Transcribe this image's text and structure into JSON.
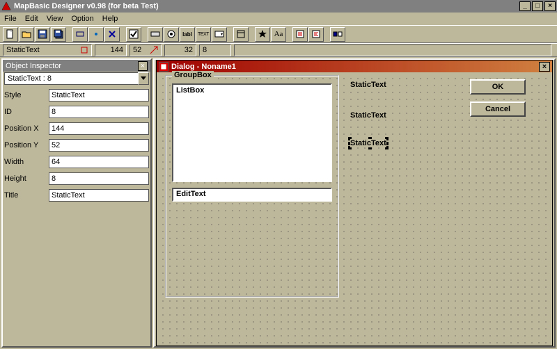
{
  "app": {
    "title": "MapBasic Designer v0.98 (for beta Test)"
  },
  "menu": {
    "items": [
      "File",
      "Edit",
      "View",
      "Option",
      "Help"
    ]
  },
  "toolbar_icons": [
    "new",
    "open",
    "save",
    "save-all",
    "rect",
    "circle",
    "cross",
    "check",
    "button",
    "radio",
    "label",
    "text",
    "dropdown",
    "frame",
    "star",
    "Aa",
    "list",
    "align",
    "panel"
  ],
  "posbar": {
    "selected": "StaticText",
    "x": "144",
    "y": "52",
    "w": "32",
    "h": "8"
  },
  "inspector": {
    "title": "Object Inspector",
    "selector": "StaticText :    8",
    "rows": [
      {
        "label": "Style",
        "value": "StaticText"
      },
      {
        "label": "ID",
        "value": "8"
      },
      {
        "label": "Position X",
        "value": "144"
      },
      {
        "label": "Position Y",
        "value": "52"
      },
      {
        "label": "Width",
        "value": "64"
      },
      {
        "label": "Height",
        "value": "8"
      },
      {
        "label": "Title",
        "value": "StaticText"
      }
    ]
  },
  "dialog": {
    "title": "Dialog - Noname1",
    "groupbox": "GroupBox",
    "listbox": "ListBox",
    "edittext": "EditText",
    "static1": "StaticText",
    "static2": "StaticText",
    "static3": "StaticText",
    "ok": "OK",
    "cancel": "Cancel"
  }
}
